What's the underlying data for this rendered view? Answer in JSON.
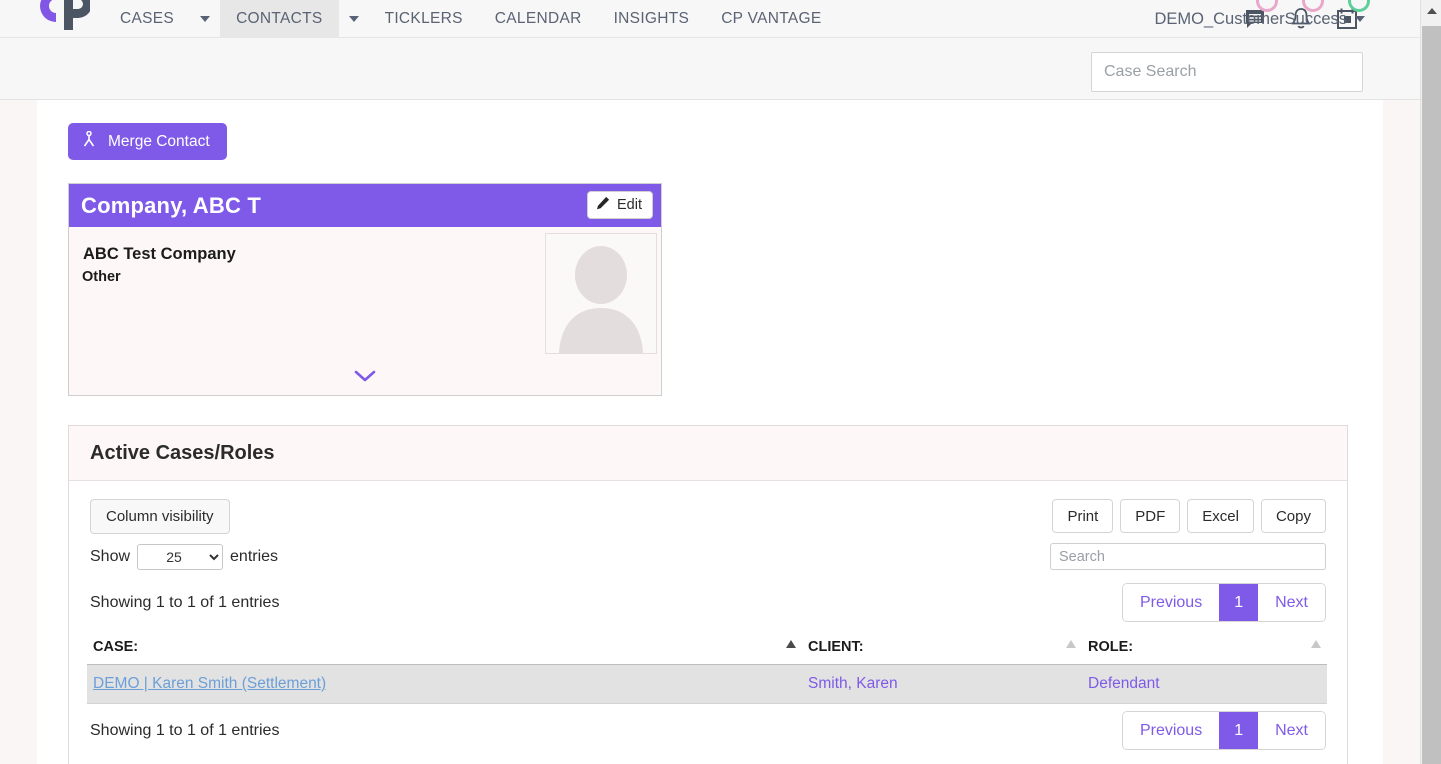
{
  "brand": {
    "logo_name": "cp-logo",
    "accent": "#7f5ae8"
  },
  "nav": {
    "items": [
      {
        "label": "CASES",
        "caret": true,
        "active": false
      },
      {
        "label": "CONTACTS",
        "caret": true,
        "active": true
      },
      {
        "label": "TICKLERS",
        "caret": false,
        "active": false
      },
      {
        "label": "CALENDAR",
        "caret": false,
        "active": false
      },
      {
        "label": "INSIGHTS",
        "caret": false,
        "active": false
      },
      {
        "label": "CP VANTAGE",
        "caret": false,
        "active": false
      }
    ],
    "icons": [
      {
        "name": "messages-icon",
        "badge_color": "#e9a7c9"
      },
      {
        "name": "notifications-bell-icon",
        "badge_color": "#e9a7c9"
      },
      {
        "name": "calendar-icon",
        "badge_color": "#5fcf9a"
      }
    ],
    "user": {
      "label": "DEMO_CustomerSuccess"
    }
  },
  "search": {
    "placeholder": "Case Search",
    "value": ""
  },
  "toolbar": {
    "merge_label": "Merge Contact",
    "merge_icon": "merge-branch-icon"
  },
  "contact_card": {
    "title": "Company, ABC T",
    "edit_label": "Edit",
    "name": "ABC Test Company",
    "type": "Other",
    "avatar_name": "contact-avatar-placeholder"
  },
  "panel": {
    "title": "Active Cases/Roles",
    "column_visibility_label": "Column visibility",
    "show_label": "Show",
    "entries_label": "entries",
    "page_length": "25",
    "page_length_options": [
      "10",
      "25",
      "50",
      "100"
    ],
    "export_buttons": [
      "Print",
      "PDF",
      "Excel",
      "Copy"
    ],
    "table_search_placeholder": "Search",
    "table_search_value": "",
    "info_text": "Showing 1 to 1 of 1 entries",
    "pagination": {
      "previous": "Previous",
      "page": "1",
      "next": "Next"
    },
    "table": {
      "columns": [
        {
          "label": "CASE:",
          "sorted": "asc"
        },
        {
          "label": "CLIENT:",
          "sorted": "none"
        },
        {
          "label": "ROLE:",
          "sorted": "none"
        }
      ],
      "rows": [
        {
          "case": "DEMO | Karen Smith (Settlement)",
          "client": "Smith, Karen",
          "role": "Defendant"
        }
      ]
    }
  },
  "scrollbar": {
    "name": "vertical-scrollbar"
  }
}
